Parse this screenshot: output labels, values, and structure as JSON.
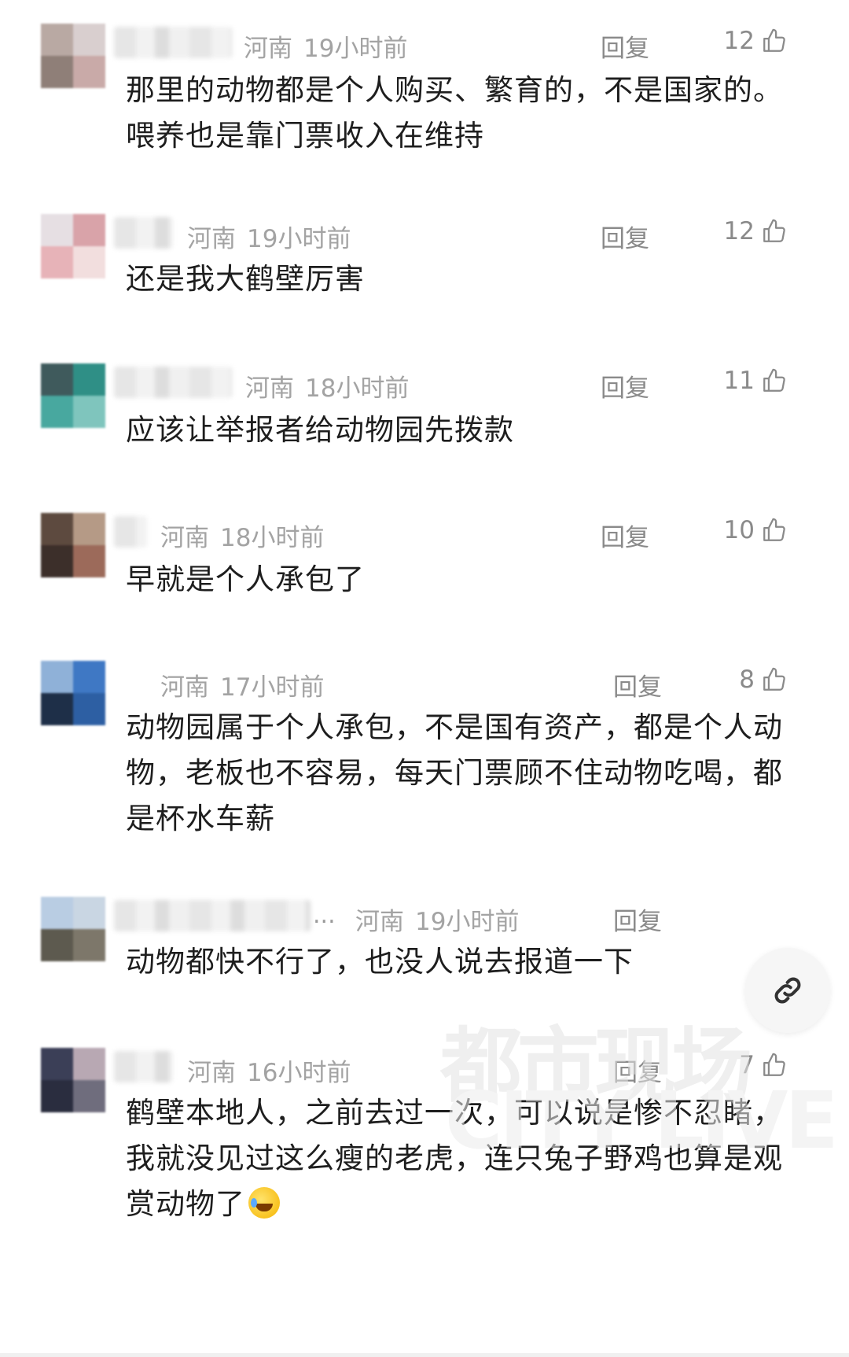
{
  "comments": [
    {
      "location": "河南",
      "time": "19小时前",
      "reply": "回复",
      "likes": "12",
      "text": "那里的动物都是个人购买、繁育的，不是国家的。喂养也是靠门票收入在维持"
    },
    {
      "location": "河南",
      "time": "19小时前",
      "reply": "回复",
      "likes": "12",
      "text": "还是我大鹤壁厉害"
    },
    {
      "location": "河南",
      "time": "18小时前",
      "reply": "回复",
      "likes": "11",
      "text": "应该让举报者给动物园先拨款"
    },
    {
      "location": "河南",
      "time": "18小时前",
      "reply": "回复",
      "likes": "10",
      "text": "早就是个人承包了"
    },
    {
      "location": "河南",
      "time": "17小时前",
      "reply": "回复",
      "likes": "8",
      "text": "动物园属于个人承包，不是国有资产，都是个人动物，老板也不容易，每天门票顾不住动物吃喝，都是杯水车薪"
    },
    {
      "location": "河南",
      "time": "19小时前",
      "reply": "回复",
      "likes": "",
      "name_ellipsis": "...",
      "text": "动物都快不行了，也没人说去报道一下"
    },
    {
      "location": "河南",
      "time": "16小时前",
      "reply": "回复",
      "likes": "7",
      "text": "鹤壁本地人，之前去过一次，可以说是惨不忍睹，我就没见过这么瘦的老虎，连只兔子野鸡也算是观赏动物了"
    }
  ],
  "icons": {
    "like": "thumbs-up-icon",
    "link": "link-icon",
    "emoji": "crying-laughing-emoji"
  },
  "watermark": {
    "line1": "都市现场",
    "line2": "CITY LIVE"
  },
  "colors": {
    "meta": "#a3a3a3",
    "action": "#8a8a8a",
    "text": "#1e1e1e"
  }
}
